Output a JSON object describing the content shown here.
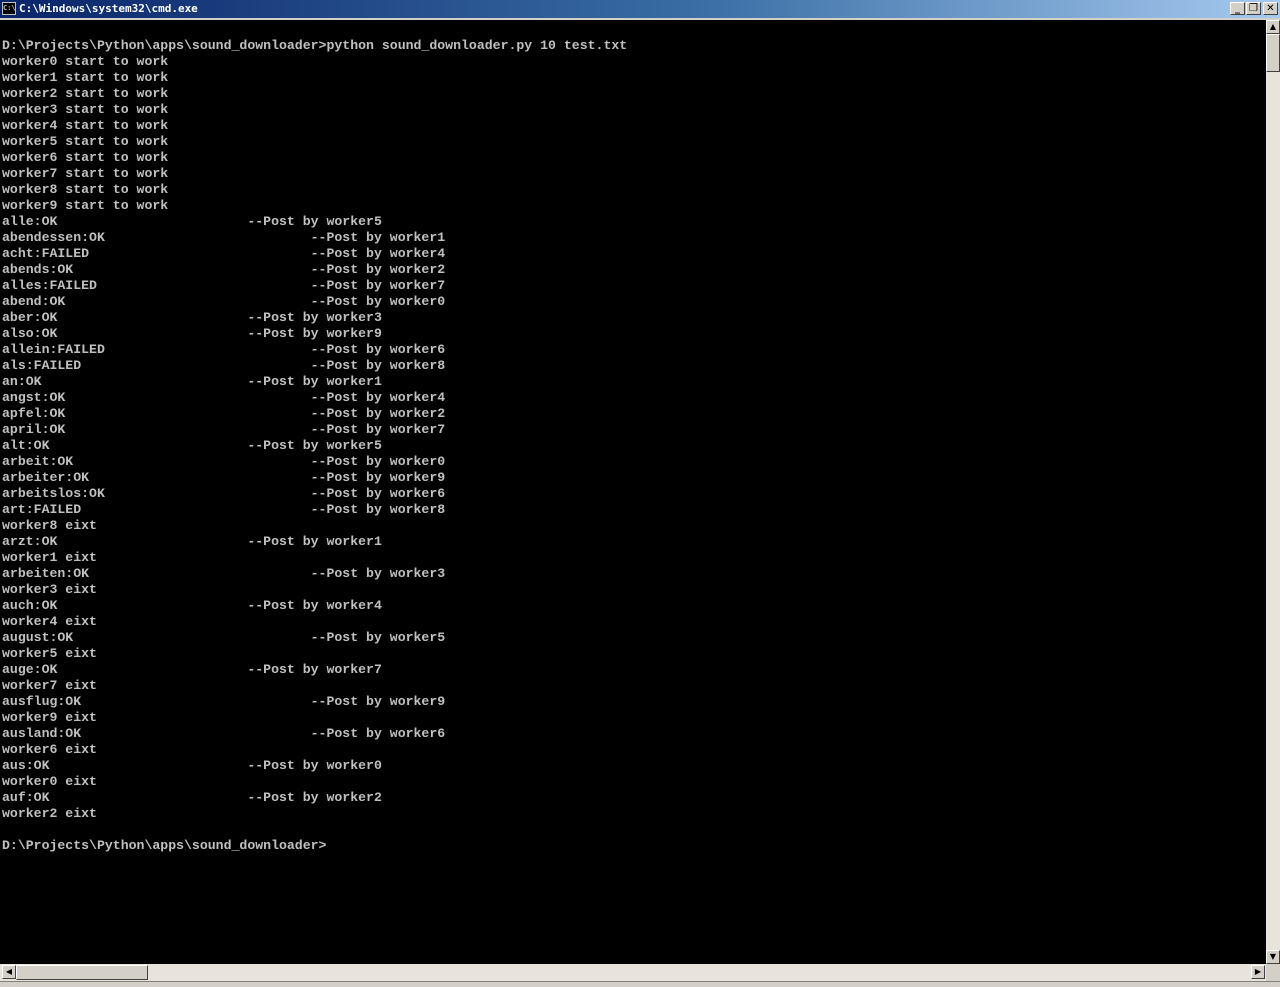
{
  "window": {
    "title": "C:\\Windows\\system32\\cmd.exe",
    "icon_text": "C:\\",
    "minimize_glyph": "_",
    "maximize_glyph": "❐",
    "close_glyph": "✕"
  },
  "console": {
    "background_color": "#000000",
    "text_color": "#c0c0c0",
    "lines": [
      "",
      "D:\\Projects\\Python\\apps\\sound_downloader>python sound_downloader.py 10 test.txt",
      "worker0 start to work",
      "worker1 start to work",
      "worker2 start to work",
      "worker3 start to work",
      "worker4 start to work",
      "worker5 start to work",
      "worker6 start to work",
      "worker7 start to work",
      "worker8 start to work",
      "worker9 start to work",
      "alle:OK                        --Post by worker5",
      "abendessen:OK                          --Post by worker1",
      "acht:FAILED                            --Post by worker4",
      "abends:OK                              --Post by worker2",
      "alles:FAILED                           --Post by worker7",
      "abend:OK                               --Post by worker0",
      "aber:OK                        --Post by worker3",
      "also:OK                        --Post by worker9",
      "allein:FAILED                          --Post by worker6",
      "als:FAILED                             --Post by worker8",
      "an:OK                          --Post by worker1",
      "angst:OK                               --Post by worker4",
      "apfel:OK                               --Post by worker2",
      "april:OK                               --Post by worker7",
      "alt:OK                         --Post by worker5",
      "arbeit:OK                              --Post by worker0",
      "arbeiter:OK                            --Post by worker9",
      "arbeitslos:OK                          --Post by worker6",
      "art:FAILED                             --Post by worker8",
      "worker8 eixt",
      "arzt:OK                        --Post by worker1",
      "worker1 eixt",
      "arbeiten:OK                            --Post by worker3",
      "worker3 eixt",
      "auch:OK                        --Post by worker4",
      "worker4 eixt",
      "august:OK                              --Post by worker5",
      "worker5 eixt",
      "auge:OK                        --Post by worker7",
      "worker7 eixt",
      "ausflug:OK                             --Post by worker9",
      "worker9 eixt",
      "ausland:OK                             --Post by worker6",
      "worker6 eixt",
      "aus:OK                         --Post by worker0",
      "worker0 eixt",
      "auf:OK                         --Post by worker2",
      "worker2 eixt",
      "",
      "D:\\Projects\\Python\\apps\\sound_downloader>"
    ]
  },
  "scrollbars": {
    "up_glyph": "▲",
    "down_glyph": "▼",
    "left_glyph": "◀",
    "right_glyph": "▶"
  }
}
